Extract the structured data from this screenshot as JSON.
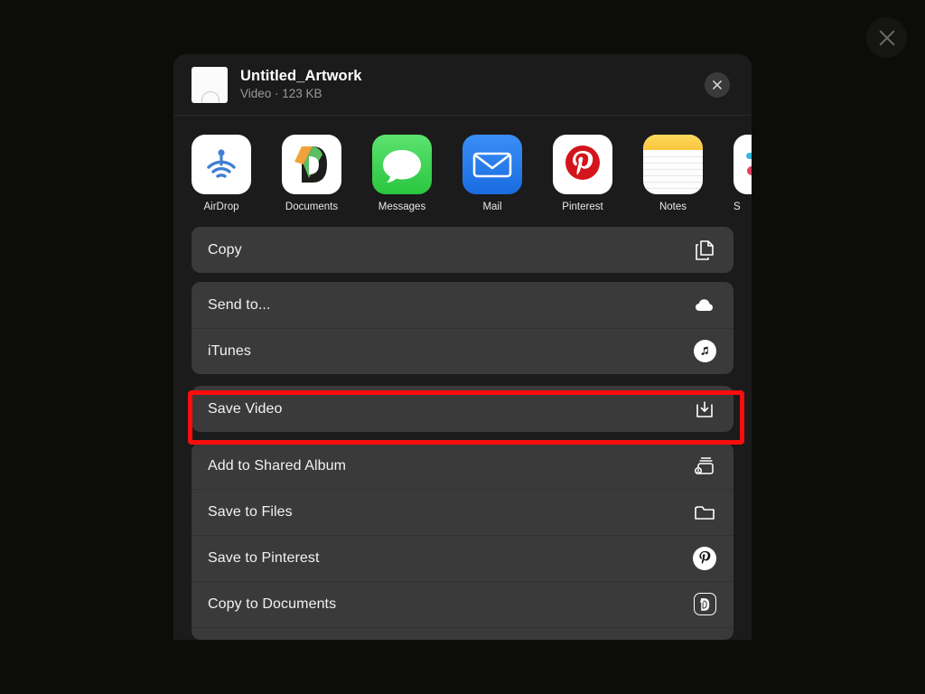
{
  "page": {
    "background_color": "#0c0c09",
    "close_icon": "close-icon"
  },
  "share_sheet": {
    "file": {
      "title": "Untitled_Artwork",
      "subtitle": "Video · 123 KB",
      "thumbnail_icon": "video-thumbnail"
    },
    "close_label": "×",
    "apps": [
      {
        "name": "AirDrop",
        "icon": "airdrop-icon"
      },
      {
        "name": "Documents",
        "icon": "documents-icon"
      },
      {
        "name": "Messages",
        "icon": "messages-icon"
      },
      {
        "name": "Mail",
        "icon": "mail-icon"
      },
      {
        "name": "Pinterest",
        "icon": "pinterest-icon"
      },
      {
        "name": "Notes",
        "icon": "notes-icon"
      },
      {
        "name": "S",
        "icon": "slack-icon"
      }
    ],
    "groups": [
      {
        "id": "copy-group",
        "rows": [
          {
            "label": "Copy",
            "icon": "copy-icon"
          }
        ]
      },
      {
        "id": "send-group",
        "rows": [
          {
            "label": "Send to...",
            "icon": "cloud-icon"
          },
          {
            "label": "iTunes",
            "icon": "itunes-icon"
          }
        ]
      },
      {
        "id": "save-video-group",
        "highlighted": true,
        "rows": [
          {
            "label": "Save Video",
            "icon": "save-download-icon"
          }
        ]
      },
      {
        "id": "actions-group",
        "rows": [
          {
            "label": "Add to Shared Album",
            "icon": "shared-album-icon"
          },
          {
            "label": "Save to Files",
            "icon": "folder-icon"
          },
          {
            "label": "Save to Pinterest",
            "icon": "pinterest-icon"
          },
          {
            "label": "Copy to Documents",
            "icon": "documents-badge-icon"
          }
        ]
      }
    ]
  },
  "colors": {
    "highlight": "#fc0d0d",
    "sheet_background": "#1b1b1b",
    "row_background": "#3a3a3a",
    "text_primary": "#f2f2f2",
    "text_secondary": "#9a9a9a"
  }
}
